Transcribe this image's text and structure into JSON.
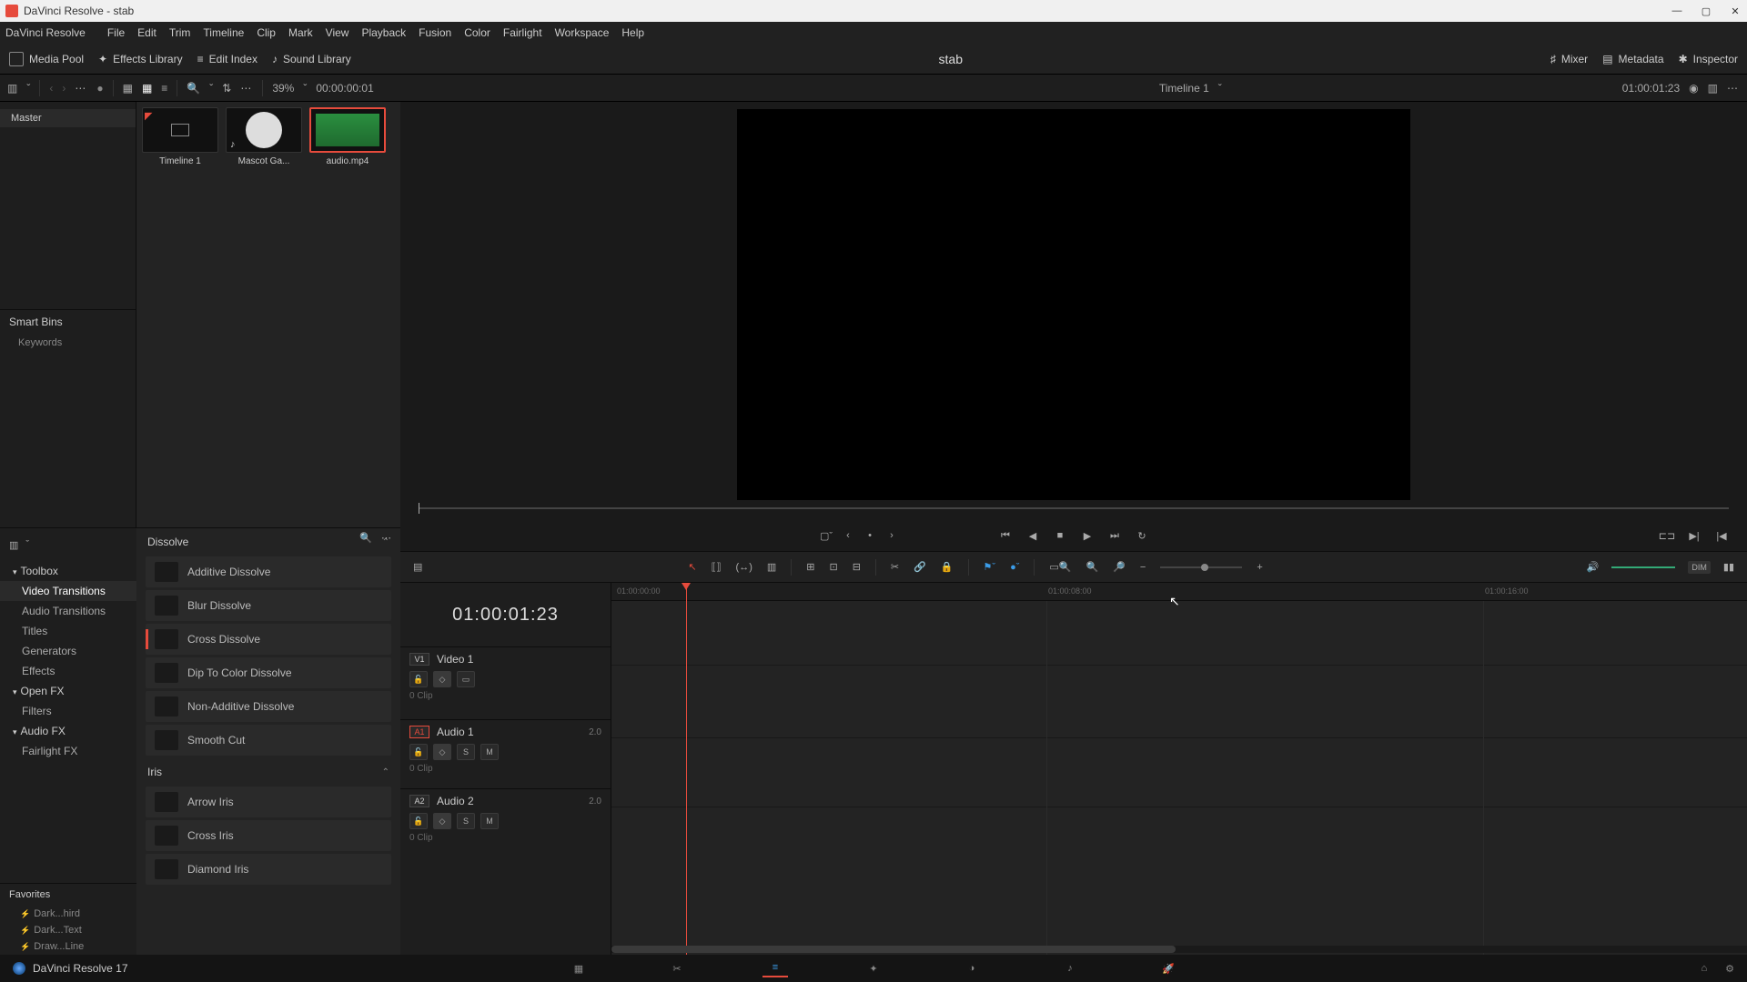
{
  "window": {
    "title": "DaVinci Resolve - stab",
    "minimize": "—",
    "maximize": "▢",
    "close": "✕"
  },
  "menubar": {
    "appname": "DaVinci Resolve",
    "items": [
      "File",
      "Edit",
      "Trim",
      "Timeline",
      "Clip",
      "Mark",
      "View",
      "Playback",
      "Fusion",
      "Color",
      "Fairlight",
      "Workspace",
      "Help"
    ]
  },
  "workspace_buttons": {
    "media_pool": "Media Pool",
    "effects_library": "Effects Library",
    "edit_index": "Edit Index",
    "sound_library": "Sound Library",
    "mixer": "Mixer",
    "metadata": "Metadata",
    "inspector": "Inspector"
  },
  "project_title": "stab",
  "subtoolbar": {
    "zoom_pct": "39%",
    "src_tc": "00:00:00:01",
    "timeline_name": "Timeline 1",
    "rec_tc": "01:00:01:23"
  },
  "bins": {
    "master": "Master",
    "smart_bins": "Smart Bins",
    "keywords": "Keywords"
  },
  "clips": [
    {
      "label": "Timeline 1",
      "kind": "timeline"
    },
    {
      "label": "Mascot Ga...",
      "kind": "video"
    },
    {
      "label": "audio.mp4",
      "kind": "audio",
      "selected": true
    }
  ],
  "fx": {
    "categories": {
      "toolbox": "Toolbox",
      "video_transitions": "Video Transitions",
      "audio_transitions": "Audio Transitions",
      "titles": "Titles",
      "generators": "Generators",
      "effects": "Effects",
      "open_fx": "Open FX",
      "filters": "Filters",
      "audio_fx": "Audio FX",
      "fairlight_fx": "Fairlight FX"
    },
    "favorites_hdr": "Favorites",
    "favorites": [
      "Dark...hird",
      "Dark...Text",
      "Draw...Line"
    ],
    "group_dissolve": "Dissolve",
    "dissolve_items": [
      "Additive Dissolve",
      "Blur Dissolve",
      "Cross Dissolve",
      "Dip To Color Dissolve",
      "Non-Additive Dissolve",
      "Smooth Cut"
    ],
    "group_iris": "Iris",
    "iris_items": [
      "Arrow Iris",
      "Cross Iris",
      "Diamond Iris"
    ]
  },
  "timeline": {
    "tc_display": "01:00:01:23",
    "ruler": [
      "01:00:00:00",
      "01:00:08:00",
      "01:00:16:00"
    ],
    "tracks": {
      "v1": {
        "id": "V1",
        "name": "Video 1",
        "clips": "0 Clip"
      },
      "a1": {
        "id": "A1",
        "name": "Audio 1",
        "ch": "2.0",
        "clips": "0 Clip"
      },
      "a2": {
        "id": "A2",
        "name": "Audio 2",
        "ch": "2.0",
        "clips": "0 Clip"
      }
    },
    "track_btn": {
      "lock": "🔓",
      "auto": "▢",
      "solo": "S",
      "mute": "M"
    },
    "dim": "DIM"
  },
  "pagebar": {
    "app_version": "DaVinci Resolve 17"
  }
}
